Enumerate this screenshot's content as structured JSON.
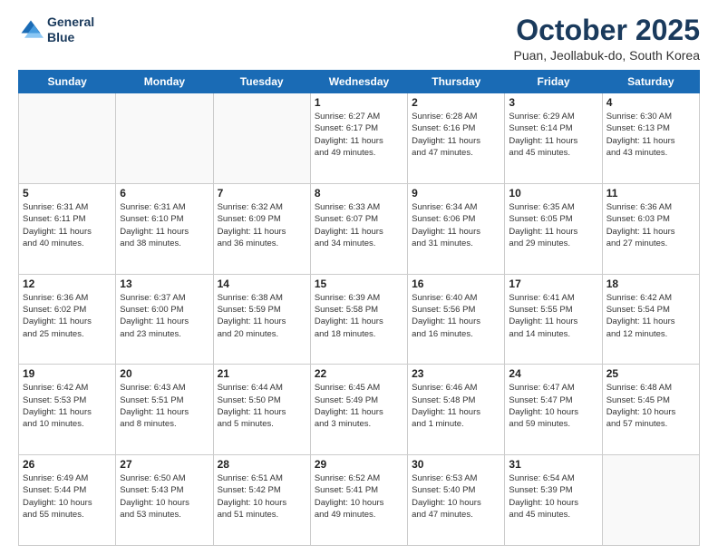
{
  "header": {
    "logo_line1": "General",
    "logo_line2": "Blue",
    "month_title": "October 2025",
    "location": "Puan, Jeollabuk-do, South Korea"
  },
  "weekdays": [
    "Sunday",
    "Monday",
    "Tuesday",
    "Wednesday",
    "Thursday",
    "Friday",
    "Saturday"
  ],
  "weeks": [
    [
      {
        "day": "",
        "info": ""
      },
      {
        "day": "",
        "info": ""
      },
      {
        "day": "",
        "info": ""
      },
      {
        "day": "1",
        "info": "Sunrise: 6:27 AM\nSunset: 6:17 PM\nDaylight: 11 hours\nand 49 minutes."
      },
      {
        "day": "2",
        "info": "Sunrise: 6:28 AM\nSunset: 6:16 PM\nDaylight: 11 hours\nand 47 minutes."
      },
      {
        "day": "3",
        "info": "Sunrise: 6:29 AM\nSunset: 6:14 PM\nDaylight: 11 hours\nand 45 minutes."
      },
      {
        "day": "4",
        "info": "Sunrise: 6:30 AM\nSunset: 6:13 PM\nDaylight: 11 hours\nand 43 minutes."
      }
    ],
    [
      {
        "day": "5",
        "info": "Sunrise: 6:31 AM\nSunset: 6:11 PM\nDaylight: 11 hours\nand 40 minutes."
      },
      {
        "day": "6",
        "info": "Sunrise: 6:31 AM\nSunset: 6:10 PM\nDaylight: 11 hours\nand 38 minutes."
      },
      {
        "day": "7",
        "info": "Sunrise: 6:32 AM\nSunset: 6:09 PM\nDaylight: 11 hours\nand 36 minutes."
      },
      {
        "day": "8",
        "info": "Sunrise: 6:33 AM\nSunset: 6:07 PM\nDaylight: 11 hours\nand 34 minutes."
      },
      {
        "day": "9",
        "info": "Sunrise: 6:34 AM\nSunset: 6:06 PM\nDaylight: 11 hours\nand 31 minutes."
      },
      {
        "day": "10",
        "info": "Sunrise: 6:35 AM\nSunset: 6:05 PM\nDaylight: 11 hours\nand 29 minutes."
      },
      {
        "day": "11",
        "info": "Sunrise: 6:36 AM\nSunset: 6:03 PM\nDaylight: 11 hours\nand 27 minutes."
      }
    ],
    [
      {
        "day": "12",
        "info": "Sunrise: 6:36 AM\nSunset: 6:02 PM\nDaylight: 11 hours\nand 25 minutes."
      },
      {
        "day": "13",
        "info": "Sunrise: 6:37 AM\nSunset: 6:00 PM\nDaylight: 11 hours\nand 23 minutes."
      },
      {
        "day": "14",
        "info": "Sunrise: 6:38 AM\nSunset: 5:59 PM\nDaylight: 11 hours\nand 20 minutes."
      },
      {
        "day": "15",
        "info": "Sunrise: 6:39 AM\nSunset: 5:58 PM\nDaylight: 11 hours\nand 18 minutes."
      },
      {
        "day": "16",
        "info": "Sunrise: 6:40 AM\nSunset: 5:56 PM\nDaylight: 11 hours\nand 16 minutes."
      },
      {
        "day": "17",
        "info": "Sunrise: 6:41 AM\nSunset: 5:55 PM\nDaylight: 11 hours\nand 14 minutes."
      },
      {
        "day": "18",
        "info": "Sunrise: 6:42 AM\nSunset: 5:54 PM\nDaylight: 11 hours\nand 12 minutes."
      }
    ],
    [
      {
        "day": "19",
        "info": "Sunrise: 6:42 AM\nSunset: 5:53 PM\nDaylight: 11 hours\nand 10 minutes."
      },
      {
        "day": "20",
        "info": "Sunrise: 6:43 AM\nSunset: 5:51 PM\nDaylight: 11 hours\nand 8 minutes."
      },
      {
        "day": "21",
        "info": "Sunrise: 6:44 AM\nSunset: 5:50 PM\nDaylight: 11 hours\nand 5 minutes."
      },
      {
        "day": "22",
        "info": "Sunrise: 6:45 AM\nSunset: 5:49 PM\nDaylight: 11 hours\nand 3 minutes."
      },
      {
        "day": "23",
        "info": "Sunrise: 6:46 AM\nSunset: 5:48 PM\nDaylight: 11 hours\nand 1 minute."
      },
      {
        "day": "24",
        "info": "Sunrise: 6:47 AM\nSunset: 5:47 PM\nDaylight: 10 hours\nand 59 minutes."
      },
      {
        "day": "25",
        "info": "Sunrise: 6:48 AM\nSunset: 5:45 PM\nDaylight: 10 hours\nand 57 minutes."
      }
    ],
    [
      {
        "day": "26",
        "info": "Sunrise: 6:49 AM\nSunset: 5:44 PM\nDaylight: 10 hours\nand 55 minutes."
      },
      {
        "day": "27",
        "info": "Sunrise: 6:50 AM\nSunset: 5:43 PM\nDaylight: 10 hours\nand 53 minutes."
      },
      {
        "day": "28",
        "info": "Sunrise: 6:51 AM\nSunset: 5:42 PM\nDaylight: 10 hours\nand 51 minutes."
      },
      {
        "day": "29",
        "info": "Sunrise: 6:52 AM\nSunset: 5:41 PM\nDaylight: 10 hours\nand 49 minutes."
      },
      {
        "day": "30",
        "info": "Sunrise: 6:53 AM\nSunset: 5:40 PM\nDaylight: 10 hours\nand 47 minutes."
      },
      {
        "day": "31",
        "info": "Sunrise: 6:54 AM\nSunset: 5:39 PM\nDaylight: 10 hours\nand 45 minutes."
      },
      {
        "day": "",
        "info": ""
      }
    ]
  ]
}
